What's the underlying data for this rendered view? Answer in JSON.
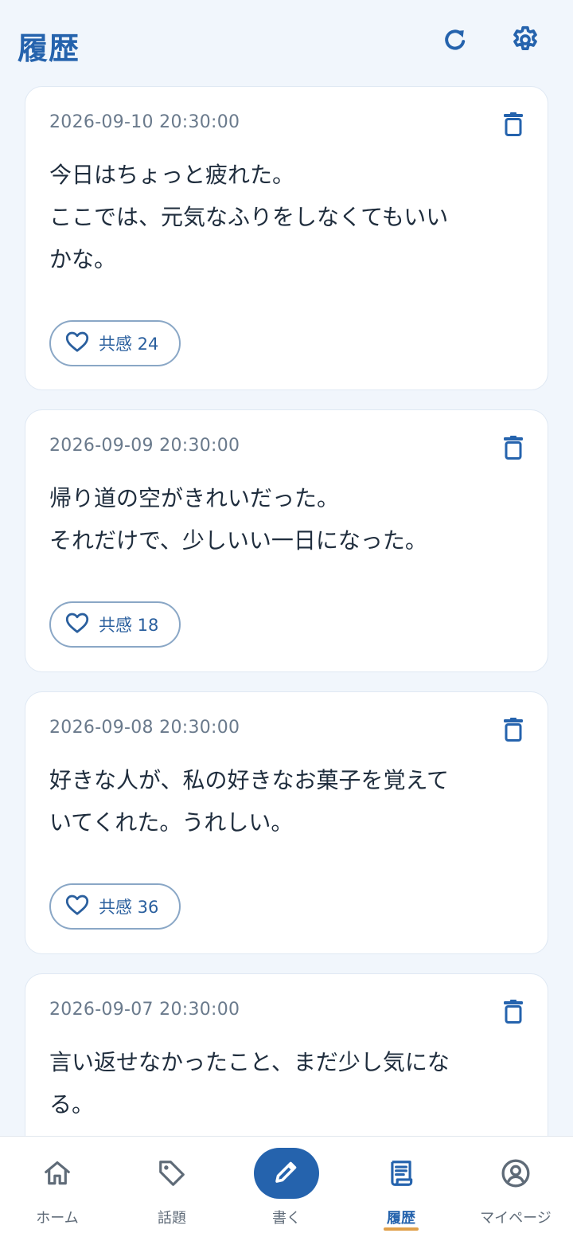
{
  "header": {
    "title": "履歴",
    "refresh_icon": "refresh-icon",
    "settings_icon": "gear-icon"
  },
  "colors": {
    "accent": "#2563ad",
    "background": "#f1f6fc",
    "active_indicator": "#e0a04a"
  },
  "posts": [
    {
      "timestamp": "2026-09-10 20:30:00",
      "body": "今日はちょっと疲れた。\nここでは、元気なふりをしなくてもいい\nかな。",
      "like_label": "共感 24"
    },
    {
      "timestamp": "2026-09-09 20:30:00",
      "body": "帰り道の空がきれいだった。\nそれだけで、少しいい一日になった。",
      "like_label": "共感 18"
    },
    {
      "timestamp": "2026-09-08 20:30:00",
      "body": "好きな人が、私の好きなお菓子を覚えて\nいてくれた。うれしい。",
      "like_label": "共感 36"
    },
    {
      "timestamp": "2026-09-07 20:30:00",
      "body": "言い返せなかったこと、まだ少し気にな\nる。"
    }
  ],
  "nav": {
    "items": [
      {
        "label": "ホーム",
        "icon": "home-icon"
      },
      {
        "label": "話題",
        "icon": "tag-icon"
      },
      {
        "label": "書く",
        "icon": "pencil-icon"
      },
      {
        "label": "履歴",
        "icon": "history-icon",
        "active": true
      },
      {
        "label": "マイページ",
        "icon": "user-circle-icon"
      }
    ]
  }
}
